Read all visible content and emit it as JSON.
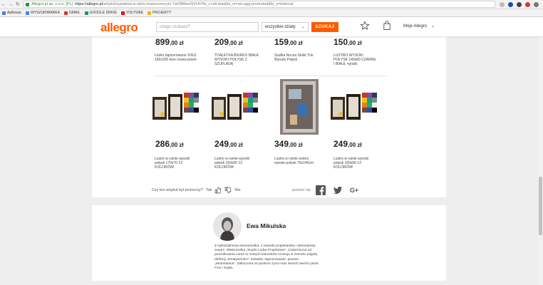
{
  "browser": {
    "secure_label": "Allegro.pl sp. z o.o. [PL]",
    "url_host": "https://allegro.pl",
    "url_path": "/artykul/sypialnia-w-stylu-nowoczesnym-7wOB8emSVUh?bi_c=all-dep&bi_m=art-agg-promoted&bi_s=internal",
    "bookmarks": [
      "Aplikacje",
      "WYSZUKIWARKA",
      "GMAIL",
      "GOOGLE DRIVE",
      "YOUTUBE",
      "PROJEKTY"
    ]
  },
  "header": {
    "logo": "allegro",
    "search_placeholder": "czego szukasz?",
    "category": "wszystkie działy",
    "search_button": "SZUKAJ",
    "account": "Moje Allegro"
  },
  "products_top": [
    {
      "price": "899",
      "decimals": ",00 zł",
      "title": "Łóżko tapicerowane VIGO 160x200 łoże nowoczesne"
    },
    {
      "price": "209",
      "decimals": ",00 zł",
      "title": "TOALETKA BIURKO BIAŁA WYSOKI POŁYSK Z SZUFLADĄ"
    },
    {
      "price": "159",
      "decimals": ",00 zł",
      "title": "Szafka Nocna Stolik Trio Wysoki Połysk"
    },
    {
      "price": "150",
      "decimals": ",00 zł",
      "title": "LUSTRO WYSOKI POŁYSK 140x60 CZARNE I BIAŁE +gratis"
    }
  ],
  "products_bottom": [
    {
      "price": "286",
      "decimals": ",00 zł",
      "title": "Lustro w ramie wysoki połysk 170x70 13 KOLORÓW!"
    },
    {
      "price": "249",
      "decimals": ",00 zł",
      "title": "Lustro w ramie wysoki połysk 160x60 13 KOLORÓW!"
    },
    {
      "price": "349",
      "decimals": ",00 zł",
      "title": "Lustro w ramie srebro wysoki połysk 70x140cm"
    },
    {
      "price": "249",
      "decimals": ",00 zł",
      "title": "Lustro w ramie wysoki połysk 160x60 13 KOLORÓW!"
    }
  ],
  "feedback": {
    "question": "Czy ten artykuł był pomocny?",
    "yes": "Tak",
    "no": "Nie"
  },
  "share": {
    "label": "podziel się"
  },
  "author": {
    "name": "Ewa Mikulska",
    "bio": "Z wykształcenia ekonomistka, z zawodu projektantka i dekoratorka wnętrz. Właścicielka „Studio Ludwi Projektowe”. Uzależniona od poszukiwania coraz to nowych kierunków rozwoju w szeroko pojętej definicji „kreatywności”: stolarka, tapicerowanie, pisanie, „wintontarius”. Zakręcona na punkcie życia oraz swoich dwóch psów: Foxi i Supła."
  },
  "colors": {
    "brand": "#ff5a00",
    "facebook": "#3b5998",
    "icon_gray": "#555555"
  }
}
